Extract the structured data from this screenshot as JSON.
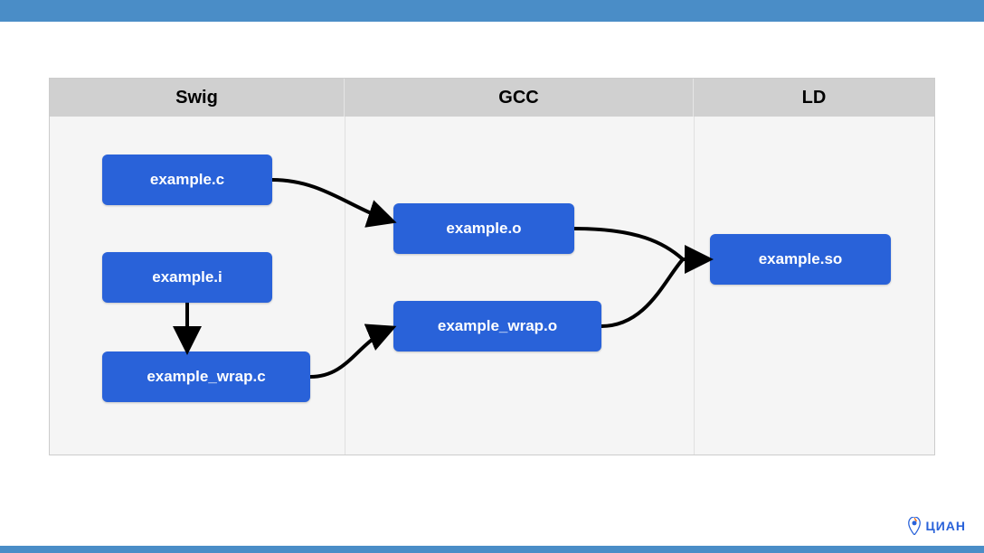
{
  "columns": {
    "swig": "Swig",
    "gcc": "GCC",
    "ld": "LD"
  },
  "nodes": {
    "example_c": "example.c",
    "example_i": "example.i",
    "example_wrap_c": "example_wrap.c",
    "example_o": "example.o",
    "example_wrap_o": "example_wrap.o",
    "example_so": "example.so"
  },
  "logo": {
    "text": "ЦИАН"
  },
  "diagram": {
    "type": "flowchart",
    "description": "Build pipeline: SWIG processes .i interface file into wrapper .c; GCC compiles .c sources into .o objects; LD links objects into shared library .so",
    "stages": [
      {
        "tool": "Swig",
        "inputs": [
          "example.i"
        ],
        "outputs": [
          "example_wrap.c"
        ]
      },
      {
        "tool": "GCC",
        "inputs": [
          "example.c",
          "example_wrap.c"
        ],
        "outputs": [
          "example.o",
          "example_wrap.o"
        ]
      },
      {
        "tool": "LD",
        "inputs": [
          "example.o",
          "example_wrap.o"
        ],
        "outputs": [
          "example.so"
        ]
      }
    ],
    "edges": [
      {
        "from": "example.i",
        "to": "example_wrap.c"
      },
      {
        "from": "example.c",
        "to": "example.o"
      },
      {
        "from": "example_wrap.c",
        "to": "example_wrap.o"
      },
      {
        "from": "example.o",
        "to": "example.so"
      },
      {
        "from": "example_wrap.o",
        "to": "example.so"
      }
    ]
  }
}
